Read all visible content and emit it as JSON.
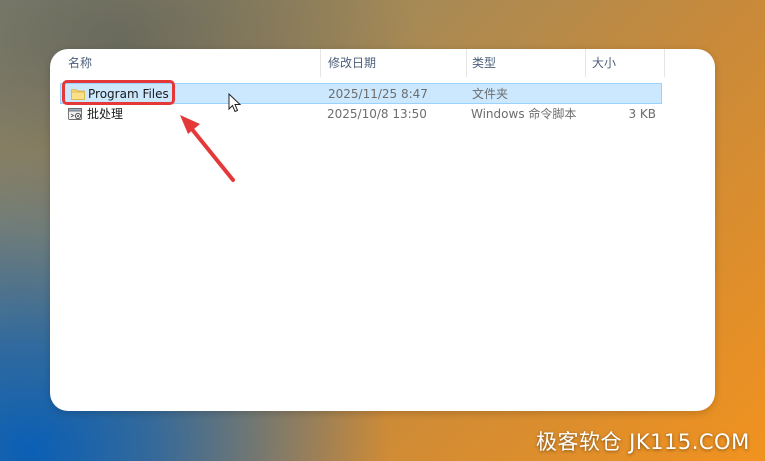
{
  "explorer": {
    "columns": [
      {
        "label": "名称"
      },
      {
        "label": "修改日期"
      },
      {
        "label": "类型"
      },
      {
        "label": "大小"
      }
    ],
    "files": [
      {
        "name": "Program Files",
        "modified": "2025/11/25 8:47",
        "type": "文件夹",
        "size": "",
        "icon": "folder-icon",
        "selected": true
      },
      {
        "name": "批处理",
        "modified": "2025/10/8 13:50",
        "type": "Windows 命令脚本",
        "size": "3 KB",
        "icon": "batch-file-icon",
        "selected": false
      }
    ]
  },
  "annotation": {
    "box_color": "#e53939",
    "arrow_color": "#e53939"
  },
  "watermark": {
    "text": "极客软仓 JK115.COM"
  },
  "colors": {
    "selection_fill": "#cce8ff",
    "selection_border": "#99d1ff",
    "header_text": "#4c607a",
    "folder": "#f7d774"
  }
}
